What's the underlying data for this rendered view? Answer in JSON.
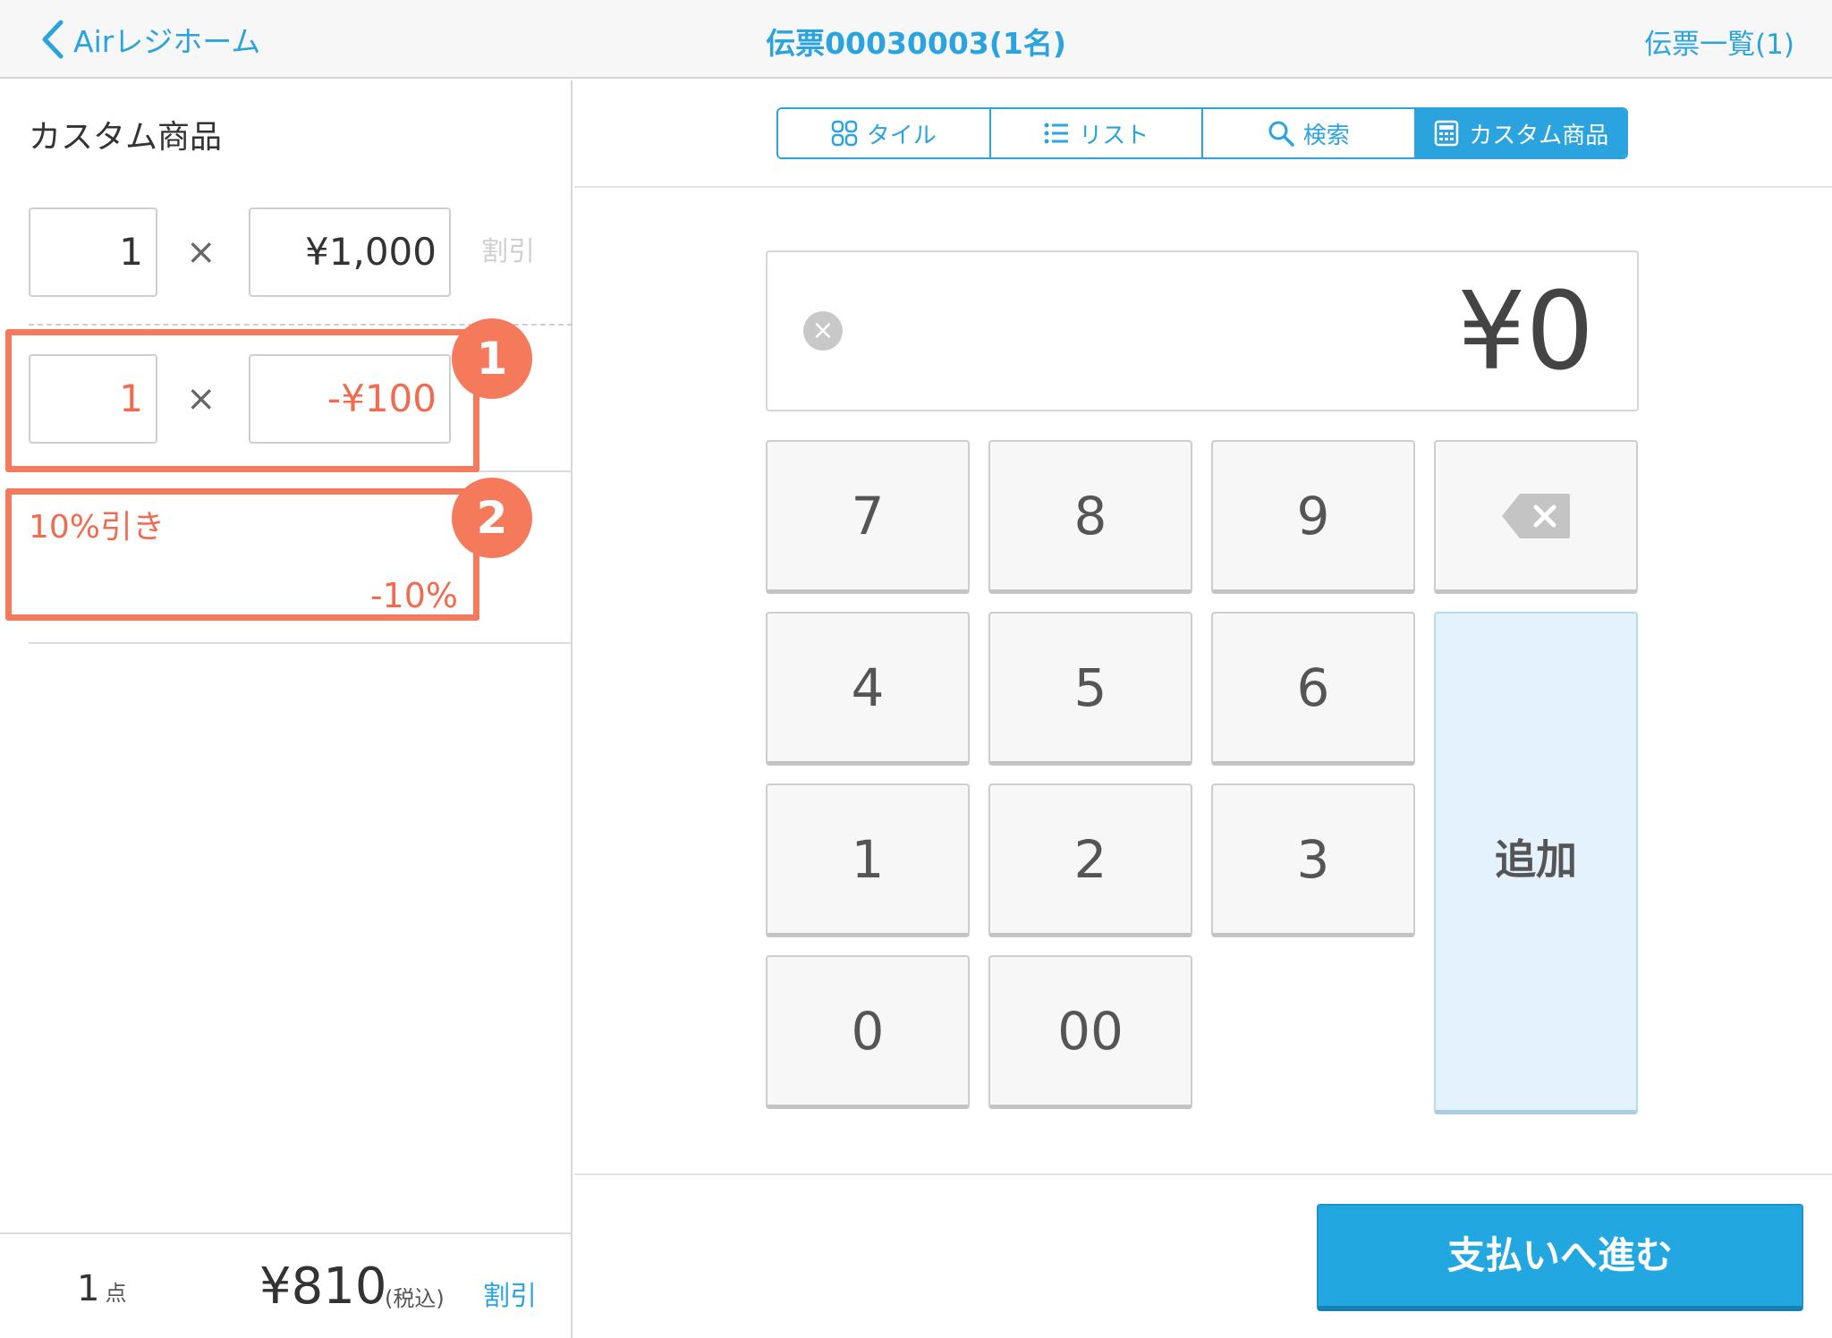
{
  "header": {
    "back_label": "Airレジホーム",
    "title": "伝票00030003(1名)",
    "right_link": "伝票一覧(1)"
  },
  "left": {
    "title": "カスタム商品",
    "item1": {
      "qty": "1",
      "times": "×",
      "price": "¥1,000",
      "discount_link": "割引"
    },
    "item2": {
      "qty": "1",
      "times": "×",
      "price": "-¥100"
    },
    "percent_discount": {
      "label": "10%引き",
      "value": "-10%"
    },
    "badges": [
      "1",
      "2"
    ],
    "footer": {
      "count": "1",
      "count_unit": "点",
      "total": "¥810",
      "tax_note": "(税込)",
      "discount_link": "割引"
    }
  },
  "tabs": [
    {
      "label": "タイル",
      "icon": "grid-icon"
    },
    {
      "label": "リスト",
      "icon": "list-icon"
    },
    {
      "label": "検索",
      "icon": "search-icon"
    },
    {
      "label": "カスタム商品",
      "icon": "calculator-icon",
      "active": true
    }
  ],
  "display": {
    "value": "¥0",
    "clear_glyph": "×"
  },
  "keypad": {
    "keys": [
      "7",
      "8",
      "9",
      "4",
      "5",
      "6",
      "1",
      "2",
      "3",
      "0",
      "00"
    ],
    "add_label": "追加"
  },
  "pay_button": "支払いへ進む",
  "colors": {
    "accent": "#2aa3df",
    "highlight": "#f57a5c",
    "discount_text": "#f06b4f"
  }
}
